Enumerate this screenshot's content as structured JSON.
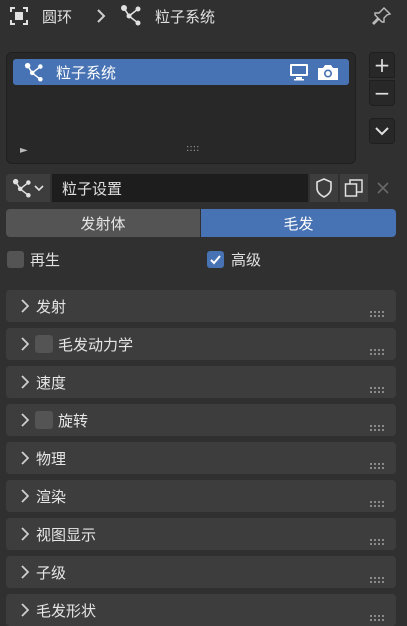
{
  "header": {
    "object_name": "圆环",
    "separator": ">",
    "system_name": "粒子系统"
  },
  "list": {
    "items": [
      {
        "label": "粒子系统"
      }
    ],
    "play_glyph": "►",
    "grip_glyph": "::::"
  },
  "side_buttons": {
    "add": "+",
    "remove": "−"
  },
  "settings": {
    "value": "粒子设置"
  },
  "tabs": [
    {
      "label": "发射体",
      "active": false
    },
    {
      "label": "毛发",
      "active": true
    }
  ],
  "options": {
    "regrow": {
      "label": "再生",
      "checked": false
    },
    "advanced": {
      "label": "高级",
      "checked": true
    }
  },
  "panels": [
    {
      "label": "发射",
      "checkbox": false
    },
    {
      "label": "毛发动力学",
      "checkbox": true
    },
    {
      "label": "速度",
      "checkbox": false
    },
    {
      "label": "旋转",
      "checkbox": true
    },
    {
      "label": "物理",
      "checkbox": false
    },
    {
      "label": "渲染",
      "checkbox": false
    },
    {
      "label": "视图显示",
      "checkbox": false
    },
    {
      "label": "子级",
      "checkbox": false
    },
    {
      "label": "毛发形状",
      "checkbox": false
    }
  ],
  "colors": {
    "background": "#303030",
    "panel": "#3d3d3d",
    "accent": "#4772b3",
    "field": "#282828"
  },
  "icons": [
    "object-icon",
    "particle-system-icon",
    "pin-icon",
    "monitor-icon",
    "camera-icon",
    "chevron-down-icon",
    "shield-icon",
    "duplicate-icon",
    "close-icon",
    "chevron-right-icon",
    "check-icon"
  ]
}
